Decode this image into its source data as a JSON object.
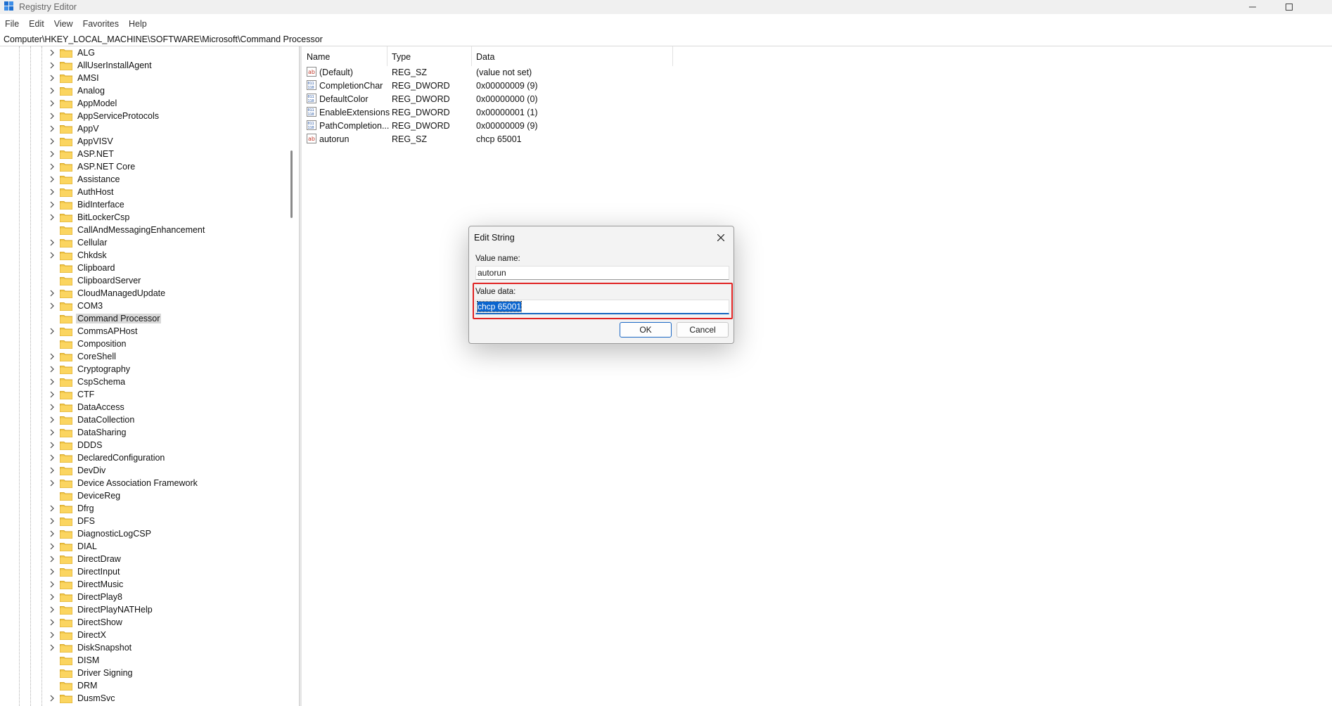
{
  "window": {
    "title": "Registry Editor"
  },
  "menu": [
    "File",
    "Edit",
    "View",
    "Favorites",
    "Help"
  ],
  "address": "Computer\\HKEY_LOCAL_MACHINE\\SOFTWARE\\Microsoft\\Command Processor",
  "tree": {
    "items": [
      {
        "label": "ALG",
        "expandable": true
      },
      {
        "label": "AllUserInstallAgent",
        "expandable": true
      },
      {
        "label": "AMSI",
        "expandable": true
      },
      {
        "label": "Analog",
        "expandable": true
      },
      {
        "label": "AppModel",
        "expandable": true
      },
      {
        "label": "AppServiceProtocols",
        "expandable": true
      },
      {
        "label": "AppV",
        "expandable": true
      },
      {
        "label": "AppVISV",
        "expandable": true
      },
      {
        "label": "ASP.NET",
        "expandable": true
      },
      {
        "label": "ASP.NET Core",
        "expandable": true
      },
      {
        "label": "Assistance",
        "expandable": true
      },
      {
        "label": "AuthHost",
        "expandable": true
      },
      {
        "label": "BidInterface",
        "expandable": true
      },
      {
        "label": "BitLockerCsp",
        "expandable": true
      },
      {
        "label": "CallAndMessagingEnhancement",
        "expandable": false
      },
      {
        "label": "Cellular",
        "expandable": true
      },
      {
        "label": "Chkdsk",
        "expandable": true
      },
      {
        "label": "Clipboard",
        "expandable": false
      },
      {
        "label": "ClipboardServer",
        "expandable": false
      },
      {
        "label": "CloudManagedUpdate",
        "expandable": true
      },
      {
        "label": "COM3",
        "expandable": true
      },
      {
        "label": "Command Processor",
        "expandable": false,
        "selected": true
      },
      {
        "label": "CommsAPHost",
        "expandable": true
      },
      {
        "label": "Composition",
        "expandable": false
      },
      {
        "label": "CoreShell",
        "expandable": true
      },
      {
        "label": "Cryptography",
        "expandable": true
      },
      {
        "label": "CspSchema",
        "expandable": true
      },
      {
        "label": "CTF",
        "expandable": true
      },
      {
        "label": "DataAccess",
        "expandable": true
      },
      {
        "label": "DataCollection",
        "expandable": true
      },
      {
        "label": "DataSharing",
        "expandable": true
      },
      {
        "label": "DDDS",
        "expandable": true
      },
      {
        "label": "DeclaredConfiguration",
        "expandable": true
      },
      {
        "label": "DevDiv",
        "expandable": true
      },
      {
        "label": "Device Association Framework",
        "expandable": true
      },
      {
        "label": "DeviceReg",
        "expandable": false
      },
      {
        "label": "Dfrg",
        "expandable": true
      },
      {
        "label": "DFS",
        "expandable": true
      },
      {
        "label": "DiagnosticLogCSP",
        "expandable": true
      },
      {
        "label": "DIAL",
        "expandable": true
      },
      {
        "label": "DirectDraw",
        "expandable": true
      },
      {
        "label": "DirectInput",
        "expandable": true
      },
      {
        "label": "DirectMusic",
        "expandable": true
      },
      {
        "label": "DirectPlay8",
        "expandable": true
      },
      {
        "label": "DirectPlayNATHelp",
        "expandable": true
      },
      {
        "label": "DirectShow",
        "expandable": true
      },
      {
        "label": "DirectX",
        "expandable": true
      },
      {
        "label": "DiskSnapshot",
        "expandable": true
      },
      {
        "label": "DISM",
        "expandable": false
      },
      {
        "label": "Driver Signing",
        "expandable": false
      },
      {
        "label": "DRM",
        "expandable": false
      },
      {
        "label": "DusmSvc",
        "expandable": true
      }
    ]
  },
  "list": {
    "columns": [
      "Name",
      "Type",
      "Data"
    ],
    "rows": [
      {
        "name": "(Default)",
        "type": "REG_SZ",
        "data": "(value not set)",
        "icon": "string-value-icon"
      },
      {
        "name": "CompletionChar",
        "type": "REG_DWORD",
        "data": "0x00000009 (9)",
        "icon": "binary-value-icon"
      },
      {
        "name": "DefaultColor",
        "type": "REG_DWORD",
        "data": "0x00000000 (0)",
        "icon": "binary-value-icon"
      },
      {
        "name": "EnableExtensions",
        "type": "REG_DWORD",
        "data": "0x00000001 (1)",
        "icon": "binary-value-icon"
      },
      {
        "name": "PathCompletion...",
        "type": "REG_DWORD",
        "data": "0x00000009 (9)",
        "icon": "binary-value-icon"
      },
      {
        "name": "autorun",
        "type": "REG_SZ",
        "data": "chcp 65001",
        "icon": "string-value-icon"
      }
    ]
  },
  "dialog": {
    "title": "Edit String",
    "value_name_label": "Value name:",
    "value_name": "autorun",
    "value_data_label": "Value data:",
    "value_data": "chcp 65001",
    "ok_label": "OK",
    "cancel_label": "Cancel"
  },
  "colors": {
    "folder": "#f2c94c",
    "selection": "#0a64ce",
    "highlight_border": "#e02424",
    "ok_border": "#1a67c4"
  }
}
